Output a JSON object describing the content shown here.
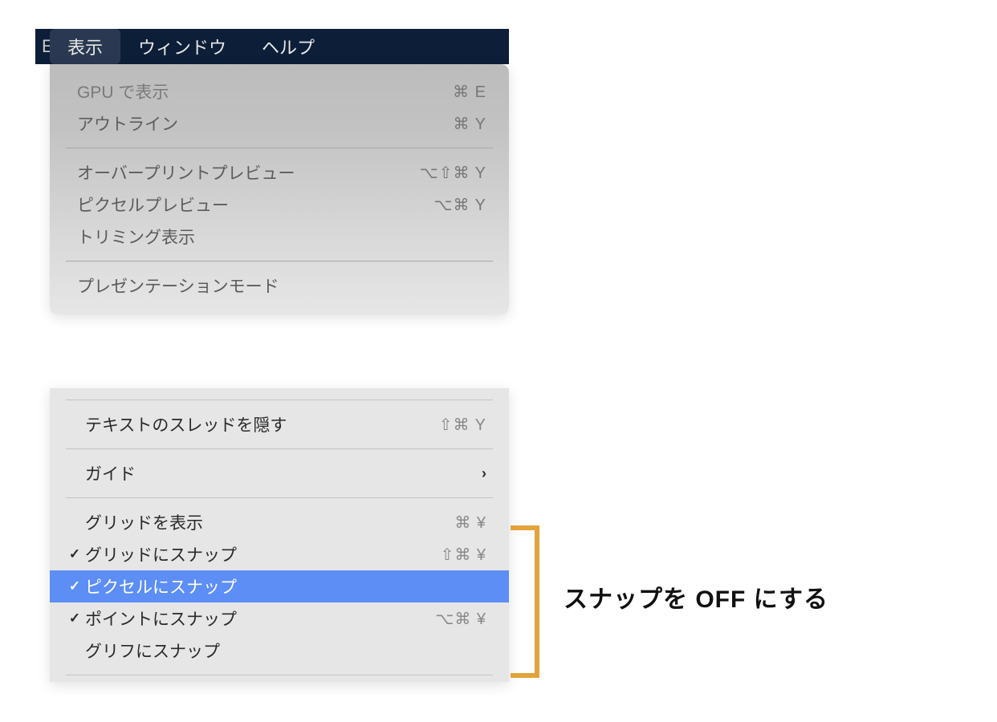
{
  "menubar": {
    "crop_hint": "E",
    "items": [
      {
        "label": "表示",
        "selected": true
      },
      {
        "label": "ウィンドウ",
        "selected": false
      },
      {
        "label": "ヘルプ",
        "selected": false
      }
    ]
  },
  "dropdown_top": {
    "section1": [
      {
        "label": "GPU で表示",
        "shortcut": "⌘ E"
      },
      {
        "label": "アウトライン",
        "shortcut": "⌘ Y"
      }
    ],
    "section2": [
      {
        "label": "オーバープリントプレビュー",
        "shortcut": "⌥⇧⌘ Y"
      },
      {
        "label": "ピクセルプレビュー",
        "shortcut": "⌥⌘ Y"
      },
      {
        "label": "トリミング表示",
        "shortcut": ""
      }
    ],
    "section3": [
      {
        "label": "プレゼンテーションモード",
        "shortcut": ""
      }
    ]
  },
  "dropdown_bottom": {
    "section1": [
      {
        "label": "テキストのスレッドを隠す",
        "shortcut": "⇧⌘ Y",
        "checked": false
      }
    ],
    "section2": [
      {
        "label": "ガイド",
        "submenu": true,
        "checked": false
      }
    ],
    "section3": [
      {
        "label": "グリッドを表示",
        "shortcut": "⌘ ¥",
        "checked": false
      },
      {
        "label": "グリッドにスナップ",
        "shortcut": "⇧⌘ ¥",
        "checked": true
      },
      {
        "label": "ピクセルにスナップ",
        "shortcut": "",
        "checked": true,
        "highlight": true
      },
      {
        "label": "ポイントにスナップ",
        "shortcut": "⌥⌘ ¥",
        "checked": true
      },
      {
        "label": "グリフにスナップ",
        "shortcut": "",
        "checked": false
      }
    ]
  },
  "annotation": {
    "text": "スナップを OFF にする",
    "bracket_color": "#e2a33a"
  }
}
